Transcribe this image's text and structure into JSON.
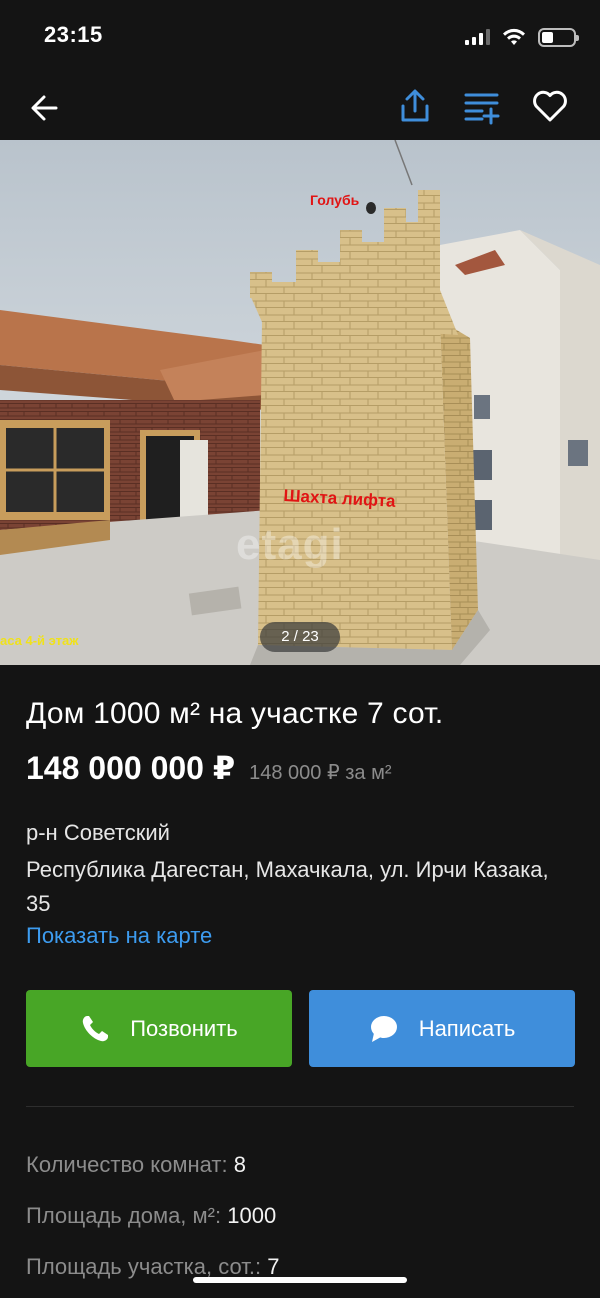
{
  "status_bar": {
    "time": "23:15",
    "battery_level": 0.35
  },
  "nav": {
    "icons": [
      "back-arrow-icon",
      "share-icon",
      "compare-list-icon",
      "heart-icon"
    ],
    "accent_color": "#3f8edb"
  },
  "gallery": {
    "counter": "2 / 23",
    "photo_annotations": {
      "pigeon": "Голубь",
      "elevator_shaft": "Шахта лифта",
      "floor_caption": "аса 4-й этаж"
    },
    "watermark": "etagi"
  },
  "listing": {
    "title": "Дом 1000 м² на участке 7 сот.",
    "price": "148 000 000 ₽",
    "price_per_m2": "148 000 ₽ за м²",
    "district": "р-н Советский",
    "address": "Республика Дагестан, Махачкала, ул. Ирчи Казака, 35",
    "map_link": "Показать на карте"
  },
  "actions": {
    "call_label": "Позвонить",
    "write_label": "Написать",
    "call_color": "#48a626",
    "write_color": "#3f8edb"
  },
  "params": [
    {
      "label": "Количество комнат:",
      "value": "8"
    },
    {
      "label": "Площадь дома, м²:",
      "value": "1000"
    },
    {
      "label": "Площадь участка, сот.:",
      "value": "7"
    }
  ]
}
